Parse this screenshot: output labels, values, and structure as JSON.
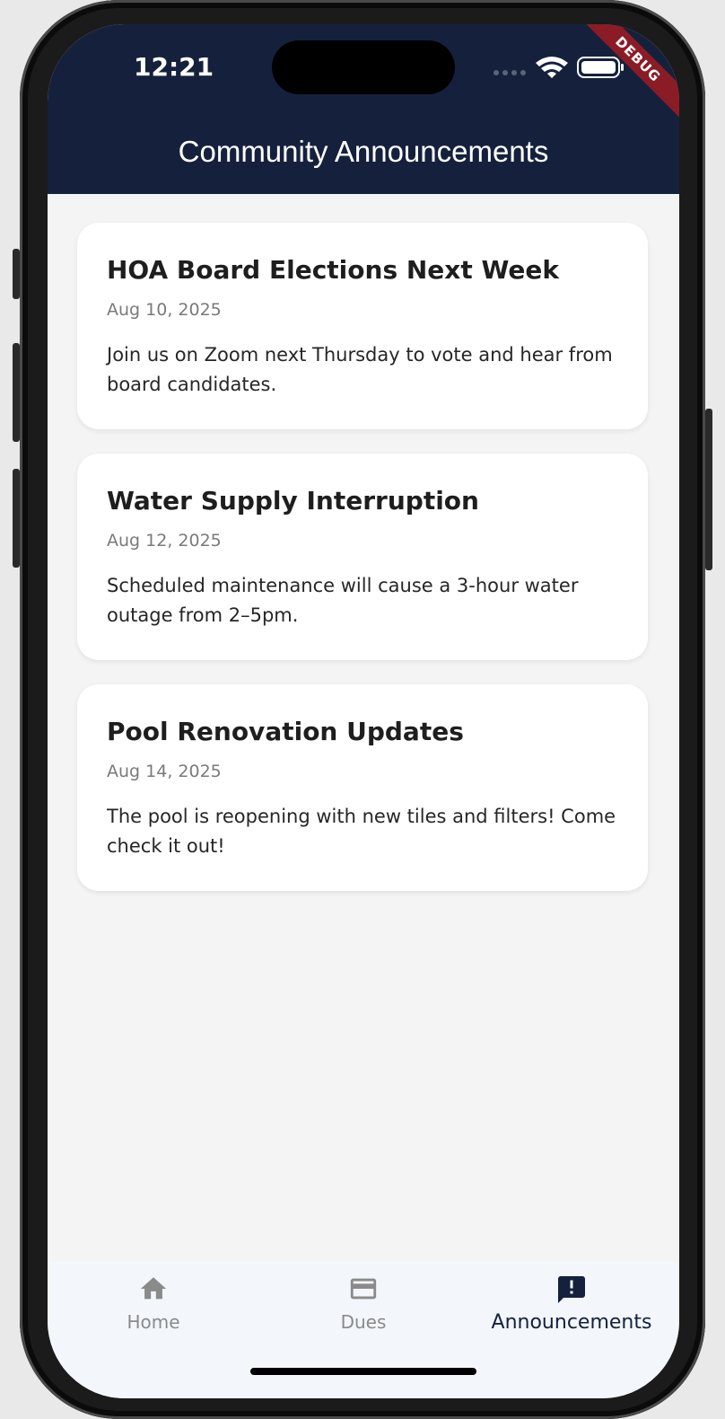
{
  "status_bar": {
    "time": "12:21"
  },
  "debug_banner": "DEBUG",
  "app_bar": {
    "title": "Community Announcements"
  },
  "announcements": [
    {
      "title": "HOA Board Elections Next Week",
      "date": "Aug 10, 2025",
      "body": "Join us on Zoom next Thursday to vote and hear from board candidates."
    },
    {
      "title": "Water Supply Interruption",
      "date": "Aug 12, 2025",
      "body": "Scheduled maintenance will cause a 3-hour water outage from 2–5pm."
    },
    {
      "title": "Pool Renovation Updates",
      "date": "Aug 14, 2025",
      "body": "The pool is reopening with new tiles and filters! Come check it out!"
    }
  ],
  "bottom_nav": {
    "items": [
      {
        "label": "Home",
        "icon": "home-icon"
      },
      {
        "label": "Dues",
        "icon": "card-icon"
      },
      {
        "label": "Announcements",
        "icon": "announcement-icon"
      }
    ],
    "active": "Announcements"
  },
  "colors": {
    "header": "#15213c",
    "background": "#f4f4f4",
    "nav_background": "#f3f6fb",
    "debug": "#8b1c26"
  }
}
